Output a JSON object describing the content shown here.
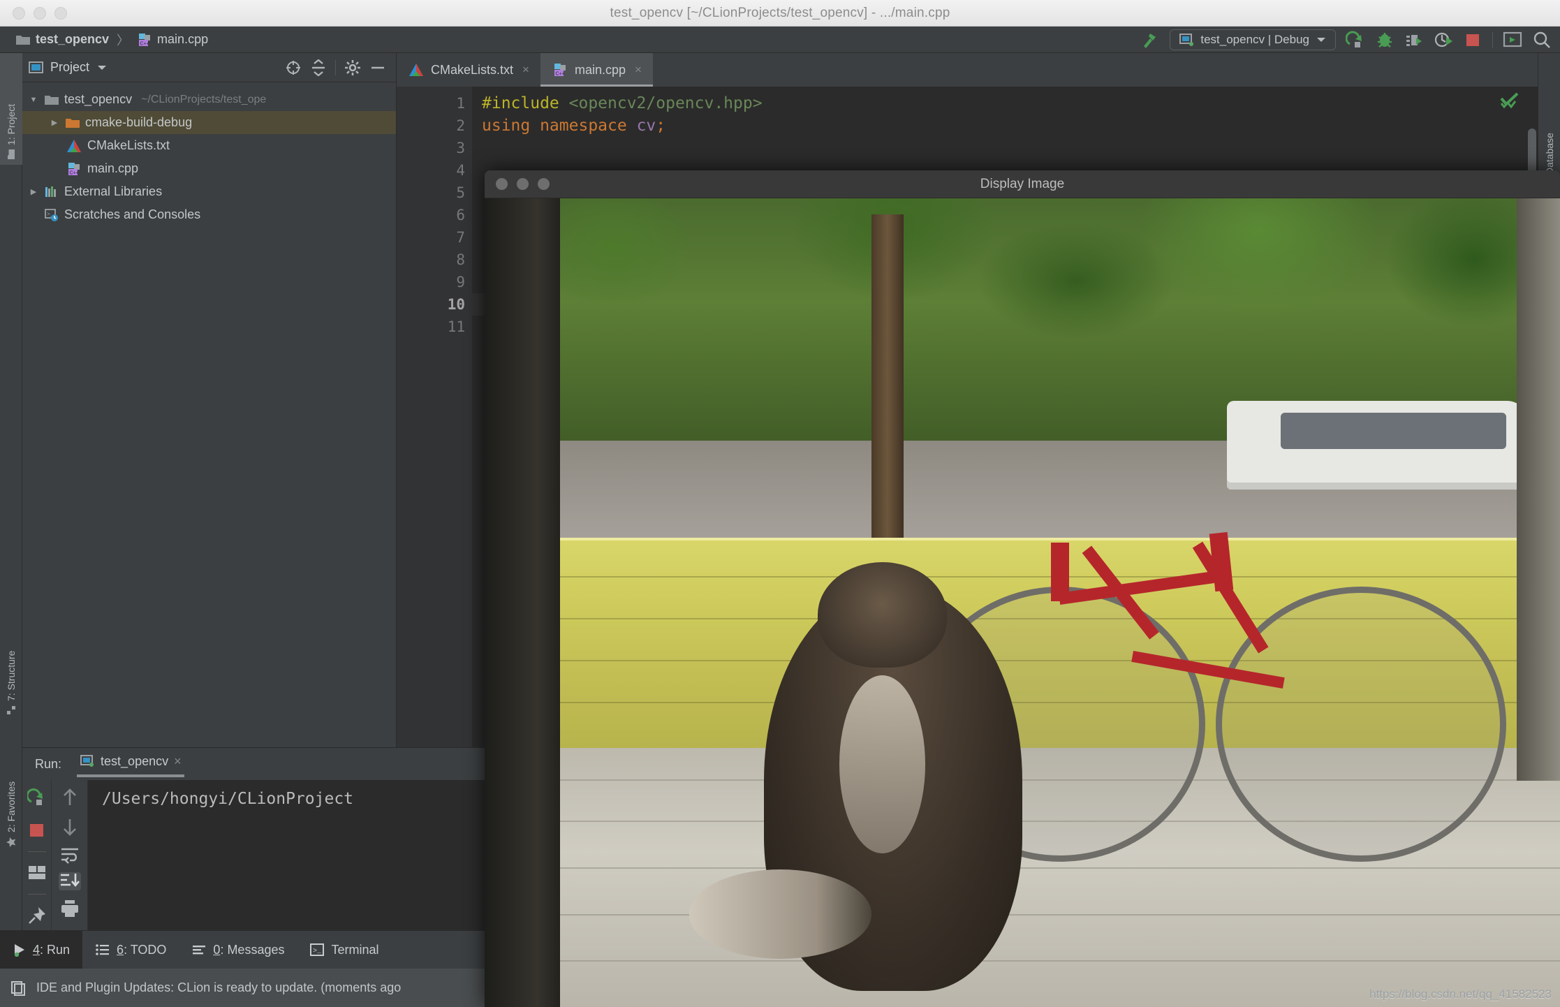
{
  "window": {
    "title": "test_opencv [~/CLionProjects/test_opencv] - .../main.cpp",
    "traffic": [
      "close",
      "minimize",
      "zoom"
    ]
  },
  "breadcrumb": {
    "project": "test_opencv",
    "separator": "〉",
    "file": "main.cpp"
  },
  "toolbar": {
    "run_config": "test_opencv | Debug",
    "icons": [
      "hammer-build-icon",
      "run-icon",
      "debug-icon",
      "run-with-coverage-icon",
      "profile-icon",
      "stop-icon",
      "terminal-icon",
      "search-everywhere-icon"
    ]
  },
  "rail_left": {
    "items": [
      {
        "label": "1: Project",
        "icon": "folder-icon",
        "active": true
      },
      {
        "label": "7: Structure",
        "icon": "structure-icon",
        "active": false
      },
      {
        "label": "2: Favorites",
        "icon": "star-icon",
        "active": false
      }
    ]
  },
  "rail_right": {
    "items": [
      {
        "label": "Database",
        "icon": "database-icon"
      }
    ]
  },
  "project_panel": {
    "title": "Project",
    "header_icons": [
      "locate-icon",
      "collapse-all-icon",
      "gear-icon",
      "hide-icon"
    ],
    "tree": [
      {
        "twist": "▼",
        "icon": "folder-icon",
        "label": "test_opencv",
        "path": "~/CLionProjects/test_ope",
        "selected": false,
        "indent": 0
      },
      {
        "twist": "▶",
        "icon": "folder-orange-icon",
        "label": "cmake-build-debug",
        "path": "",
        "selected": true,
        "indent": 1
      },
      {
        "twist": "",
        "icon": "cmake-icon",
        "label": "CMakeLists.txt",
        "path": "",
        "selected": false,
        "indent": 1
      },
      {
        "twist": "",
        "icon": "cpp-file-icon",
        "label": "main.cpp",
        "path": "",
        "selected": false,
        "indent": 1
      },
      {
        "twist": "▶",
        "icon": "libraries-icon",
        "label": "External Libraries",
        "path": "",
        "selected": false,
        "indent": 0
      },
      {
        "twist": "",
        "icon": "scratches-icon",
        "label": "Scratches and Consoles",
        "path": "",
        "selected": false,
        "indent": 0
      }
    ]
  },
  "editor": {
    "tabs": [
      {
        "label": "CMakeLists.txt",
        "icon": "cmake-icon",
        "active": false,
        "close": "×"
      },
      {
        "label": "main.cpp",
        "icon": "cpp-file-icon",
        "active": true,
        "close": "×"
      }
    ],
    "line_numbers": [
      "1",
      "2",
      "3",
      "4",
      "5",
      "6",
      "7",
      "8",
      "9",
      "10",
      "11"
    ],
    "current_line": "10",
    "run_marker_line": "3",
    "lines": [
      {
        "n": "1",
        "tokens": [
          {
            "t": "#include ",
            "c": "kw-pre"
          },
          {
            "t": "<opencv2/opencv.hpp>",
            "c": "kw-str"
          }
        ]
      },
      {
        "n": "2",
        "tokens": [
          {
            "t": "using namespace ",
            "c": "kw-key"
          },
          {
            "t": "cv",
            "c": "kw-id"
          },
          {
            "t": ";",
            "c": "kw-key"
          }
        ]
      }
    ],
    "inspection_status": "ok-check-icon"
  },
  "run_panel": {
    "label": "Run:",
    "tab": "test_opencv",
    "tab_close": "×",
    "console_text": "/Users/hongyi/CLionProject",
    "left_tools": [
      "rerun-icon",
      "stop-icon",
      "layout-icon",
      "pin-icon"
    ],
    "right_tools": [
      "up-icon",
      "down-icon",
      "soft-wrap-icon",
      "scroll-to-end-icon",
      "print-icon",
      "more-icon"
    ]
  },
  "bottom_bar": {
    "items": [
      {
        "num": "4",
        "label": ": Run",
        "icon": "run-icon",
        "active": true
      },
      {
        "num": "6",
        "label": ": TODO",
        "icon": "todo-icon",
        "active": false
      },
      {
        "num": "0",
        "label": ": Messages",
        "icon": "messages-icon",
        "active": false
      },
      {
        "num": "",
        "label": "Terminal",
        "icon": "terminal-icon",
        "active": false
      }
    ]
  },
  "status_bar": {
    "icon": "notification-icon",
    "message": "IDE and Plugin Updates: CLion is ready to update. (moments ago"
  },
  "image_window": {
    "title": "Display Image",
    "watermark": "https://blog.csdn.net/qq_41582523"
  },
  "colors": {
    "accent_green": "#499c54",
    "stop_red": "#c75450",
    "selection": "#4f4b36",
    "editor_bg": "#2b2b2b",
    "panel_bg": "#3c3f41"
  }
}
